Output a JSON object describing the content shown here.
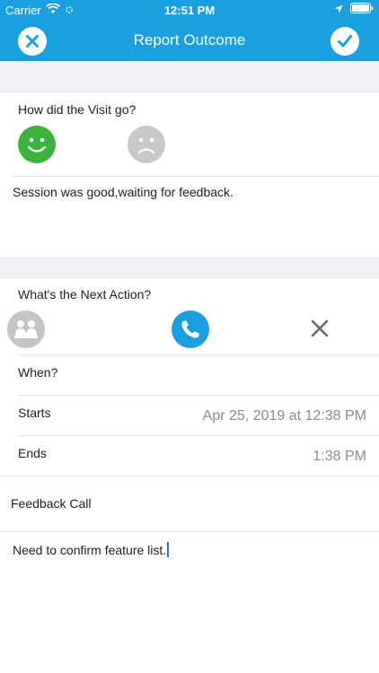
{
  "status_bar": {
    "carrier": "Carrier",
    "time": "12:51 PM"
  },
  "nav": {
    "title": "Report Outcome",
    "close_icon": "close-icon",
    "done_icon": "checkmark-icon"
  },
  "visit": {
    "question": "How did the Visit go?",
    "good_icon": "smiley-happy-icon",
    "bad_icon": "smiley-sad-icon",
    "notes": "Session was good,waiting for feedback."
  },
  "next_action": {
    "question": "What's the Next Action?",
    "icons": [
      "meeting-icon",
      "phone-icon",
      "close-icon"
    ],
    "when_label": "When?",
    "starts_label": "Starts",
    "starts_value": "Apr 25, 2019 at 12:38 PM",
    "ends_label": "Ends",
    "ends_value": "1:38 PM",
    "title": "Feedback Call",
    "notes": "Need to confirm feature list."
  },
  "colors": {
    "accent": "#1a9fe0",
    "good": "#3cb43c",
    "neutral": "#c8c8c8",
    "section_gap": "#efeff4"
  }
}
